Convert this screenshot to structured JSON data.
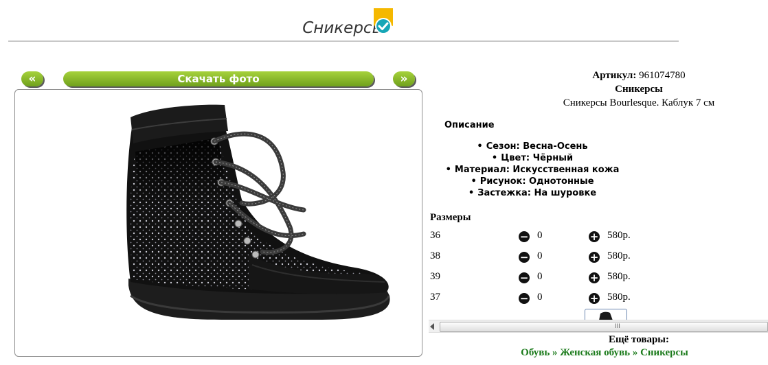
{
  "title": "Сникерсы",
  "nav": {
    "prev_label": "«",
    "download_label": "Скачать фото",
    "next_label": "»"
  },
  "product": {
    "article_label": "Артикул:",
    "article_value": "961074780",
    "name": "Сникерсы",
    "subtitle": "Сникерсы Bourlesque. Каблук 7 см"
  },
  "description": {
    "heading": "Описание",
    "properties": [
      "Сезон: Весна-Осень",
      "Цвет: Чёрный",
      "Материал: Искусственная кожа",
      "Рисунок: Однотонные",
      "Застежка: На шуровке"
    ]
  },
  "sizes": {
    "heading": "Размеры",
    "rows": [
      {
        "size": "36",
        "qty": "0",
        "price": "580р."
      },
      {
        "size": "38",
        "qty": "0",
        "price": "580р."
      },
      {
        "size": "39",
        "qty": "0",
        "price": "580р."
      },
      {
        "size": "37",
        "qty": "0",
        "price": "580р."
      }
    ]
  },
  "more": {
    "label": "Ещё товары:",
    "crumbs": [
      "Обувь",
      "Женская обувь",
      "Сникерсы"
    ],
    "separator": "»"
  },
  "scrollbar_grip": "III"
}
